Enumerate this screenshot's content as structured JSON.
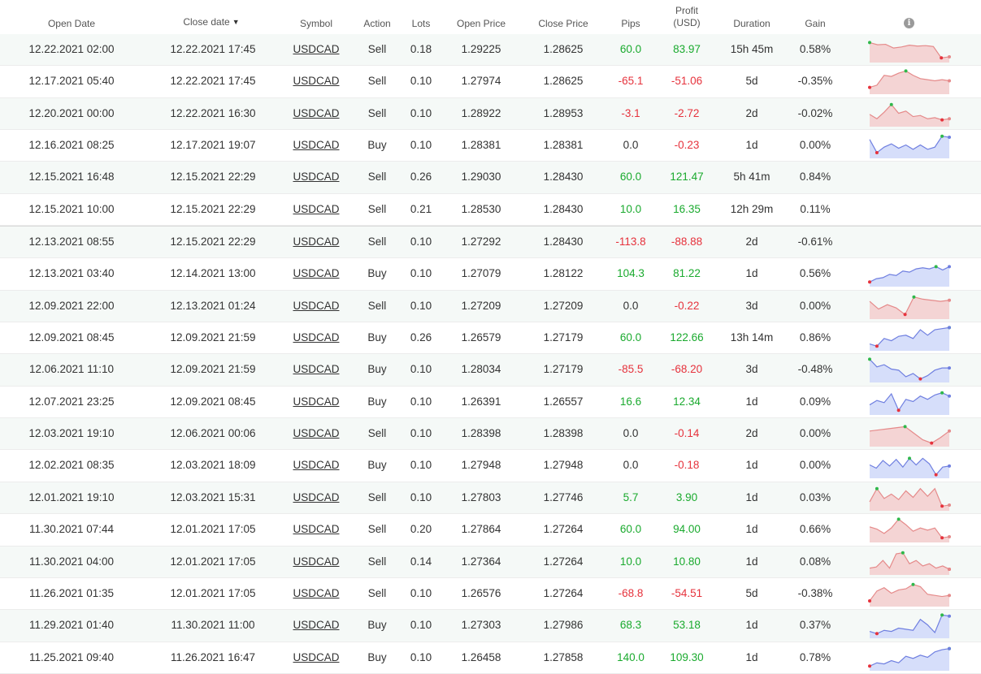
{
  "header": {
    "open_date": "Open Date",
    "close_date": "Close date",
    "sort_indicator": "▼",
    "symbol": "Symbol",
    "action": "Action",
    "lots": "Lots",
    "open_price": "Open Price",
    "close_price": "Close Price",
    "pips": "Pips",
    "profit_line1": "Profit",
    "profit_line2": "(USD)",
    "duration": "Duration",
    "gain": "Gain",
    "info_icon": "info-icon"
  },
  "colors": {
    "positive": "#1aaa2e",
    "negative": "#e6323c",
    "sell_fill": "#f4d4d4",
    "sell_line": "#e58a8a",
    "buy_fill": "#d6defa",
    "buy_line": "#6f7fe0",
    "marker_high": "#2eb84a",
    "marker_low": "#e6323c"
  },
  "trades": [
    {
      "open_date": "12.22.2021 02:00",
      "close_date": "12.22.2021 17:45",
      "symbol": "USDCAD",
      "action": "Sell",
      "lots": "0.18",
      "open_price": "1.29225",
      "close_price": "1.28625",
      "pips": "60.0",
      "profit": "83.97",
      "duration": "15h 45m",
      "gain": "0.58%",
      "pips_sign": "pos",
      "profit_sign": "pos",
      "spark": [
        0.8,
        0.7,
        0.72,
        0.55,
        0.6,
        0.68,
        0.64,
        0.66,
        0.62,
        0.1,
        0.15
      ]
    },
    {
      "open_date": "12.17.2021 05:40",
      "close_date": "12.22.2021 17:45",
      "symbol": "USDCAD",
      "action": "Sell",
      "lots": "0.10",
      "open_price": "1.27974",
      "close_price": "1.28625",
      "pips": "-65.1",
      "profit": "-51.06",
      "duration": "5d",
      "gain": "-0.35%",
      "pips_sign": "neg",
      "profit_sign": "neg",
      "spark": [
        0.2,
        0.3,
        0.75,
        0.7,
        0.85,
        0.95,
        0.75,
        0.6,
        0.55,
        0.5,
        0.55,
        0.5
      ]
    },
    {
      "open_date": "12.20.2021 00:00",
      "close_date": "12.22.2021 16:30",
      "symbol": "USDCAD",
      "action": "Sell",
      "lots": "0.10",
      "open_price": "1.28922",
      "close_price": "1.28953",
      "pips": "-3.1",
      "profit": "-2.72",
      "duration": "2d",
      "gain": "-0.02%",
      "pips_sign": "neg",
      "profit_sign": "neg",
      "spark": [
        0.45,
        0.25,
        0.55,
        0.9,
        0.5,
        0.6,
        0.35,
        0.4,
        0.25,
        0.3,
        0.2,
        0.25
      ]
    },
    {
      "open_date": "12.16.2021 08:25",
      "close_date": "12.17.2021 19:07",
      "symbol": "USDCAD",
      "action": "Buy",
      "lots": "0.10",
      "open_price": "1.28381",
      "close_price": "1.28381",
      "pips": "0.0",
      "profit": "-0.23",
      "duration": "1d",
      "gain": "0.00%",
      "pips_sign": "neu",
      "profit_sign": "neg",
      "spark": [
        0.75,
        0.15,
        0.4,
        0.55,
        0.35,
        0.5,
        0.3,
        0.5,
        0.3,
        0.4,
        0.9,
        0.85
      ]
    },
    {
      "open_date": "12.15.2021 16:48",
      "close_date": "12.15.2021 22:29",
      "symbol": "USDCAD",
      "action": "Sell",
      "lots": "0.26",
      "open_price": "1.29030",
      "close_price": "1.28430",
      "pips": "60.0",
      "profit": "121.47",
      "duration": "5h 41m",
      "gain": "0.84%",
      "pips_sign": "pos",
      "profit_sign": "pos",
      "spark": []
    },
    {
      "open_date": "12.15.2021 10:00",
      "close_date": "12.15.2021 22:29",
      "symbol": "USDCAD",
      "action": "Sell",
      "lots": "0.21",
      "open_price": "1.28530",
      "close_price": "1.28430",
      "pips": "10.0",
      "profit": "16.35",
      "duration": "12h 29m",
      "gain": "0.11%",
      "pips_sign": "pos",
      "profit_sign": "pos",
      "spark": []
    },
    {
      "open_date": "12.13.2021 08:55",
      "close_date": "12.15.2021 22:29",
      "symbol": "USDCAD",
      "action": "Sell",
      "lots": "0.10",
      "open_price": "1.27292",
      "close_price": "1.28430",
      "pips": "-113.8",
      "profit": "-88.88",
      "duration": "2d",
      "gain": "-0.61%",
      "pips_sign": "neg",
      "profit_sign": "neg",
      "spark": []
    },
    {
      "open_date": "12.13.2021 03:40",
      "close_date": "12.14.2021 13:00",
      "symbol": "USDCAD",
      "action": "Buy",
      "lots": "0.10",
      "open_price": "1.27079",
      "close_price": "1.28122",
      "pips": "104.3",
      "profit": "81.22",
      "duration": "1d",
      "gain": "0.56%",
      "pips_sign": "pos",
      "profit_sign": "pos",
      "spark": [
        0.1,
        0.25,
        0.3,
        0.45,
        0.4,
        0.6,
        0.55,
        0.7,
        0.75,
        0.7,
        0.8,
        0.65,
        0.8
      ]
    },
    {
      "open_date": "12.09.2021 22:00",
      "close_date": "12.13.2021 01:24",
      "symbol": "USDCAD",
      "action": "Sell",
      "lots": "0.10",
      "open_price": "1.27209",
      "close_price": "1.27209",
      "pips": "0.0",
      "profit": "-0.22",
      "duration": "3d",
      "gain": "0.00%",
      "pips_sign": "neu",
      "profit_sign": "neg",
      "spark": [
        0.7,
        0.35,
        0.55,
        0.4,
        0.1,
        0.9,
        0.8,
        0.75,
        0.7,
        0.75
      ]
    },
    {
      "open_date": "12.09.2021 08:45",
      "close_date": "12.09.2021 21:59",
      "symbol": "USDCAD",
      "action": "Buy",
      "lots": "0.26",
      "open_price": "1.26579",
      "close_price": "1.27179",
      "pips": "60.0",
      "profit": "122.66",
      "duration": "13h 14m",
      "gain": "0.86%",
      "pips_sign": "pos",
      "profit_sign": "pos",
      "spark": [
        0.2,
        0.1,
        0.45,
        0.35,
        0.55,
        0.6,
        0.45,
        0.85,
        0.6,
        0.85,
        0.9,
        0.95
      ]
    },
    {
      "open_date": "12.06.2021 11:10",
      "close_date": "12.09.2021 21:59",
      "symbol": "USDCAD",
      "action": "Buy",
      "lots": "0.10",
      "open_price": "1.28034",
      "close_price": "1.27179",
      "pips": "-85.5",
      "profit": "-68.20",
      "duration": "3d",
      "gain": "-0.48%",
      "pips_sign": "neg",
      "profit_sign": "neg",
      "spark": [
        0.95,
        0.6,
        0.7,
        0.5,
        0.45,
        0.15,
        0.3,
        0.05,
        0.2,
        0.45,
        0.55,
        0.55
      ]
    },
    {
      "open_date": "12.07.2021 23:25",
      "close_date": "12.09.2021 08:45",
      "symbol": "USDCAD",
      "action": "Buy",
      "lots": "0.10",
      "open_price": "1.26391",
      "close_price": "1.26557",
      "pips": "16.6",
      "profit": "12.34",
      "duration": "1d",
      "gain": "0.09%",
      "pips_sign": "pos",
      "profit_sign": "pos",
      "spark": [
        0.35,
        0.55,
        0.45,
        0.85,
        0.1,
        0.6,
        0.5,
        0.75,
        0.6,
        0.8,
        0.9,
        0.75
      ]
    },
    {
      "open_date": "12.03.2021 19:10",
      "close_date": "12.06.2021 00:06",
      "symbol": "USDCAD",
      "action": "Sell",
      "lots": "0.10",
      "open_price": "1.28398",
      "close_price": "1.28398",
      "pips": "0.0",
      "profit": "-0.14",
      "duration": "2d",
      "gain": "0.00%",
      "pips_sign": "neu",
      "profit_sign": "neg",
      "spark": [
        0.6,
        0.65,
        0.7,
        0.75,
        0.8,
        0.5,
        0.2,
        0.05,
        0.3,
        0.6
      ]
    },
    {
      "open_date": "12.02.2021 08:35",
      "close_date": "12.03.2021 18:09",
      "symbol": "USDCAD",
      "action": "Buy",
      "lots": "0.10",
      "open_price": "1.27948",
      "close_price": "1.27948",
      "pips": "0.0",
      "profit": "-0.18",
      "duration": "1d",
      "gain": "0.00%",
      "pips_sign": "neu",
      "profit_sign": "neg",
      "spark": [
        0.5,
        0.35,
        0.7,
        0.45,
        0.75,
        0.4,
        0.8,
        0.5,
        0.8,
        0.55,
        0.05,
        0.4,
        0.45
      ]
    },
    {
      "open_date": "12.01.2021 19:10",
      "close_date": "12.03.2021 15:31",
      "symbol": "USDCAD",
      "action": "Sell",
      "lots": "0.10",
      "open_price": "1.27803",
      "close_price": "1.27746",
      "pips": "5.7",
      "profit": "3.90",
      "duration": "1d",
      "gain": "0.03%",
      "pips_sign": "pos",
      "profit_sign": "pos",
      "spark": [
        0.3,
        0.9,
        0.45,
        0.65,
        0.4,
        0.8,
        0.5,
        0.9,
        0.55,
        0.9,
        0.1,
        0.15
      ]
    },
    {
      "open_date": "11.30.2021 07:44",
      "close_date": "12.01.2021 17:05",
      "symbol": "USDCAD",
      "action": "Sell",
      "lots": "0.20",
      "open_price": "1.27864",
      "close_price": "1.27264",
      "pips": "60.0",
      "profit": "94.00",
      "duration": "1d",
      "gain": "0.66%",
      "pips_sign": "pos",
      "profit_sign": "pos",
      "spark": [
        0.6,
        0.5,
        0.3,
        0.55,
        0.95,
        0.7,
        0.4,
        0.55,
        0.45,
        0.55,
        0.1,
        0.15
      ]
    },
    {
      "open_date": "11.30.2021 04:00",
      "close_date": "12.01.2021 17:05",
      "symbol": "USDCAD",
      "action": "Sell",
      "lots": "0.14",
      "open_price": "1.27364",
      "close_price": "1.27264",
      "pips": "10.0",
      "profit": "10.80",
      "duration": "1d",
      "gain": "0.08%",
      "pips_sign": "pos",
      "profit_sign": "pos",
      "spark": [
        0.2,
        0.25,
        0.55,
        0.2,
        0.85,
        0.9,
        0.4,
        0.55,
        0.3,
        0.4,
        0.2,
        0.3,
        0.15
      ]
    },
    {
      "open_date": "11.26.2021 01:35",
      "close_date": "12.01.2021 17:05",
      "symbol": "USDCAD",
      "action": "Sell",
      "lots": "0.10",
      "open_price": "1.26576",
      "close_price": "1.27264",
      "pips": "-68.8",
      "profit": "-54.51",
      "duration": "5d",
      "gain": "-0.38%",
      "pips_sign": "neg",
      "profit_sign": "neg",
      "spark": [
        0.15,
        0.6,
        0.75,
        0.5,
        0.65,
        0.7,
        0.9,
        0.8,
        0.45,
        0.4,
        0.35,
        0.4
      ]
    },
    {
      "open_date": "11.29.2021 01:40",
      "close_date": "11.30.2021 11:00",
      "symbol": "USDCAD",
      "action": "Buy",
      "lots": "0.10",
      "open_price": "1.27303",
      "close_price": "1.27986",
      "pips": "68.3",
      "profit": "53.18",
      "duration": "1d",
      "gain": "0.37%",
      "pips_sign": "pos",
      "profit_sign": "pos",
      "spark": [
        0.2,
        0.1,
        0.25,
        0.2,
        0.35,
        0.3,
        0.25,
        0.75,
        0.5,
        0.15,
        0.95,
        0.9
      ]
    },
    {
      "open_date": "11.25.2021 09:40",
      "close_date": "11.26.2021 16:47",
      "symbol": "USDCAD",
      "action": "Buy",
      "lots": "0.10",
      "open_price": "1.26458",
      "close_price": "1.27858",
      "pips": "140.0",
      "profit": "109.30",
      "duration": "1d",
      "gain": "0.78%",
      "pips_sign": "pos",
      "profit_sign": "pos",
      "spark": [
        0.1,
        0.25,
        0.2,
        0.35,
        0.25,
        0.55,
        0.45,
        0.6,
        0.5,
        0.75,
        0.85,
        0.9
      ]
    }
  ]
}
